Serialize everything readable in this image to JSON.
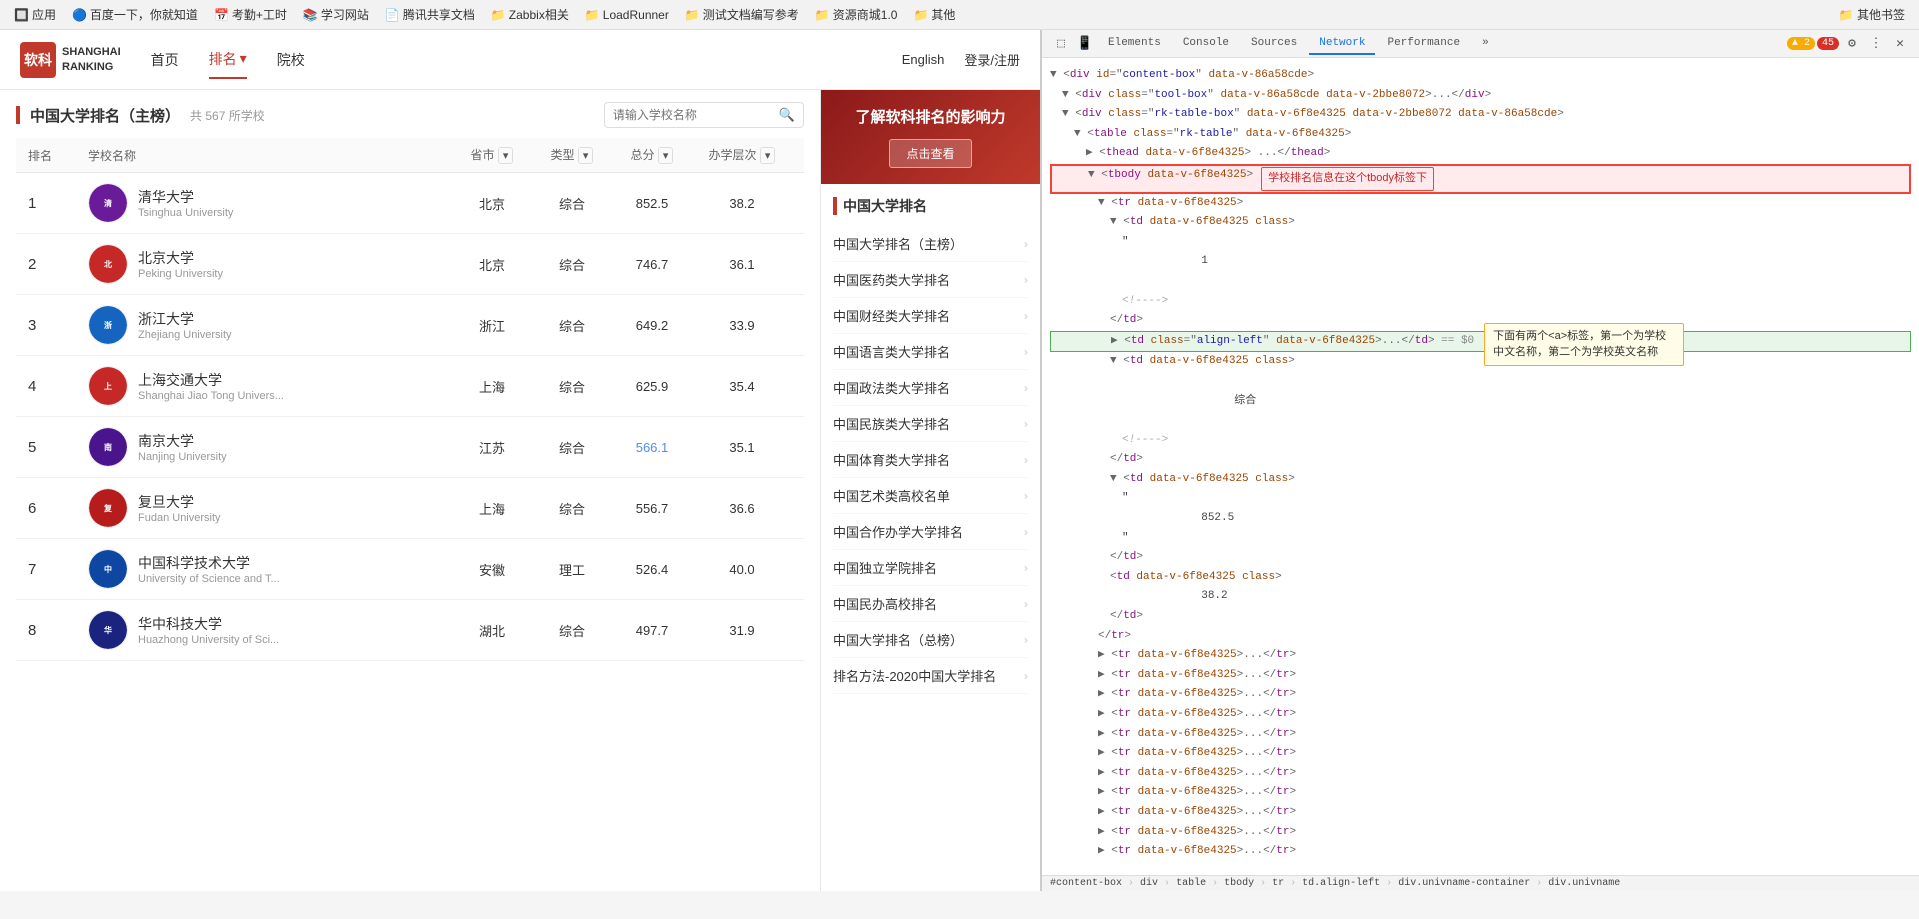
{
  "browser": {
    "buttons": [
      "close",
      "minimize",
      "maximize"
    ],
    "bookmarks": [
      {
        "label": "应用",
        "icon": "🔲"
      },
      {
        "label": "百度一下，你就知道",
        "icon": "🔵"
      },
      {
        "label": "考勤+工时",
        "icon": "📅"
      },
      {
        "label": "学习网站",
        "icon": "📚"
      },
      {
        "label": "腾讯共享文档",
        "icon": "📄"
      },
      {
        "label": "Zabbix相关",
        "icon": "📁"
      },
      {
        "label": "LoadRunner",
        "icon": "📁"
      },
      {
        "label": "测试文档编写参考",
        "icon": "📁"
      },
      {
        "label": "资源商城1.0",
        "icon": "📁"
      },
      {
        "label": "其他",
        "icon": "📁"
      },
      {
        "label": "其他书签",
        "icon": "📁"
      }
    ]
  },
  "site": {
    "logo_line1": "软科",
    "logo_line2": "SHANGHAI\nRANKING",
    "nav": {
      "home": "首页",
      "ranking": "排名",
      "university": "院校",
      "lang": "English",
      "login": "登录/注册"
    },
    "ranking": {
      "title": "中国大学排名（主榜）",
      "count": "共 567 所学校",
      "search_placeholder": "请输入学校名称",
      "columns": {
        "rank": "排名",
        "name": "学校名称",
        "province": "省市",
        "type": "类型",
        "score": "总分",
        "level": "办学层次"
      },
      "schools": [
        {
          "rank": 1,
          "name_cn": "清华大学",
          "name_en": "Tsinghua University",
          "province": "北京",
          "type": "综合",
          "score": "852.5",
          "level": "38.2",
          "color": "#6a1b9a"
        },
        {
          "rank": 2,
          "name_cn": "北京大学",
          "name_en": "Peking University",
          "province": "北京",
          "type": "综合",
          "score": "746.7",
          "level": "36.1",
          "color": "#c62828"
        },
        {
          "rank": 3,
          "name_cn": "浙江大学",
          "name_en": "Zhejiang University",
          "province": "浙江",
          "type": "综合",
          "score": "649.2",
          "level": "33.9",
          "color": "#1565c0"
        },
        {
          "rank": 4,
          "name_cn": "上海交通大学",
          "name_en": "Shanghai Jiao Tong Univers...",
          "province": "上海",
          "type": "综合",
          "score": "625.9",
          "level": "35.4",
          "color": "#c62828"
        },
        {
          "rank": 5,
          "name_cn": "南京大学",
          "name_en": "Nanjing University",
          "province": "江苏",
          "type": "综合",
          "score": "566.1",
          "level": "35.1",
          "color": "#4a148c"
        },
        {
          "rank": 6,
          "name_cn": "复旦大学",
          "name_en": "Fudan University",
          "province": "上海",
          "type": "综合",
          "score": "556.7",
          "level": "36.6",
          "color": "#b71c1c"
        },
        {
          "rank": 7,
          "name_cn": "中国科学技术大学",
          "name_en": "University of Science and T...",
          "province": "安徽",
          "type": "理工",
          "score": "526.4",
          "level": "40.0",
          "color": "#0d47a1"
        },
        {
          "rank": 8,
          "name_cn": "华中科技大学",
          "name_en": "Huazhong University of Sci...",
          "province": "湖北",
          "type": "综合",
          "score": "497.7",
          "level": "31.9",
          "color": "#1a237e"
        }
      ]
    }
  },
  "sidebar": {
    "ad": {
      "title": "了解软科排名的影响力",
      "btn": "点击查看"
    },
    "section_title": "中国大学排名",
    "items": [
      {
        "label": "中国大学排名（主榜）"
      },
      {
        "label": "中国医药类大学排名"
      },
      {
        "label": "中国财经类大学排名"
      },
      {
        "label": "中国语言类大学排名"
      },
      {
        "label": "中国政法类大学排名"
      },
      {
        "label": "中国民族类大学排名"
      },
      {
        "label": "中国体育类大学排名"
      },
      {
        "label": "中国艺术类高校名单"
      },
      {
        "label": "中国合作办学大学排名"
      },
      {
        "label": "中国独立学院排名"
      },
      {
        "label": "中国民办高校排名"
      },
      {
        "label": "中国大学排名（总榜）"
      },
      {
        "label": "排名方法-2020中国大学排名"
      }
    ]
  },
  "devtools": {
    "tabs": [
      "Elements",
      "Console",
      "Sources",
      "Network",
      "Performance"
    ],
    "active_tab": "Elements",
    "network_label": "Network",
    "badge_warning": "2",
    "badge_error": "45",
    "html_lines": [
      {
        "indent": 0,
        "content": "▼ <div id=\"content-box\" data-v-86a58cde>",
        "type": "tag"
      },
      {
        "indent": 1,
        "content": "▼ <div class=\"tool-box data-v-86a58cde data-v-2bbe8072\">...</div>",
        "type": "tag"
      },
      {
        "indent": 1,
        "content": "▼ <div class=\"rk-table-box\" data-v-6f8e4325 data-v-2bbe8072 data-v-86a58cde>",
        "type": "tag"
      },
      {
        "indent": 2,
        "content": "▼ <table class=\"rk-table\" data-v-6f8e4325>",
        "type": "tag"
      },
      {
        "indent": 3,
        "content": "▶ <thead data-v-6f8e4325> ...</thead>",
        "type": "tag"
      },
      {
        "indent": 3,
        "content": "▼ <tbody data-v-6f8e4325>",
        "type": "tag",
        "annotation_red": "学校排名信息在这个tbody标签下"
      },
      {
        "indent": 4,
        "content": "▼ <tr data-v-6f8e4325>",
        "type": "tag"
      },
      {
        "indent": 5,
        "content": "▼ <td data-v-6f8e4325 class>",
        "type": "tag"
      },
      {
        "indent": 6,
        "content": "\"",
        "type": "text"
      },
      {
        "indent": 6,
        "content": "1",
        "type": "text"
      },
      {
        "indent": 6,
        "content": "",
        "type": "spacer"
      },
      {
        "indent": 6,
        "content": "<!---->",
        "type": "comment"
      },
      {
        "indent": 5,
        "content": "</td>",
        "type": "close"
      },
      {
        "indent": 5,
        "content": "▶ <td class=\"align-left\" data-v-6f8e4325>...</td>  == $0",
        "type": "tag-selected",
        "annotation_green": "下面有两个<a>标签，第一个为学校中文名称，第二个为学校英文名称"
      },
      {
        "indent": 5,
        "content": "▼ <td data-v-6f8e4325 class>",
        "type": "tag"
      },
      {
        "indent": 6,
        "content": "",
        "type": "spacer"
      },
      {
        "indent": 6,
        "content": "综合",
        "type": "text"
      },
      {
        "indent": 6,
        "content": "",
        "type": "spacer"
      },
      {
        "indent": 6,
        "content": "<!---->",
        "type": "comment"
      },
      {
        "indent": 5,
        "content": "</td>",
        "type": "close"
      },
      {
        "indent": 5,
        "content": "▼ <td data-v-6f8e4325 class>",
        "type": "tag"
      },
      {
        "indent": 6,
        "content": "\"",
        "type": "text"
      },
      {
        "indent": 6,
        "content": "852.5",
        "type": "text"
      },
      {
        "indent": 6,
        "content": "\"",
        "type": "text"
      },
      {
        "indent": 5,
        "content": "</td>",
        "type": "close"
      },
      {
        "indent": 5,
        "content": "<td data-v-6f8e4325 class>",
        "type": "tag"
      },
      {
        "indent": 6,
        "content": "38.2",
        "type": "text"
      },
      {
        "indent": 5,
        "content": "</td>",
        "type": "close"
      },
      {
        "indent": 4,
        "content": "</tr>",
        "type": "close"
      },
      {
        "indent": 4,
        "content": "▶ <tr data-v-6f8e4325>...</tr>",
        "type": "tag"
      },
      {
        "indent": 4,
        "content": "▶ <tr data-v-6f8e4325>...</tr>",
        "type": "tag"
      },
      {
        "indent": 4,
        "content": "▶ <tr data-v-6f8e4325>...</tr>",
        "type": "tag"
      },
      {
        "indent": 4,
        "content": "▶ <tr data-v-6f8e4325>...</tr>",
        "type": "tag"
      },
      {
        "indent": 4,
        "content": "▶ <tr data-v-6f8e4325>...</tr>",
        "type": "tag"
      },
      {
        "indent": 4,
        "content": "▶ <tr data-v-6f8e4325>...</tr>",
        "type": "tag"
      },
      {
        "indent": 4,
        "content": "▶ <tr data-v-6f8e4325>...</tr>",
        "type": "tag"
      },
      {
        "indent": 4,
        "content": "▶ <tr data-v-6f8e4325>...</tr>",
        "type": "tag"
      },
      {
        "indent": 4,
        "content": "▶ <tr data-v-6f8e4325>...</tr>",
        "type": "tag"
      },
      {
        "indent": 4,
        "content": "▶ <tr data-v-6f8e4325>...</tr>",
        "type": "tag"
      }
    ],
    "statusbar": [
      "#content-box",
      "div",
      "table",
      "tbody",
      "tr",
      "td.align-left",
      "div.univname-container",
      "div.univname"
    ]
  }
}
